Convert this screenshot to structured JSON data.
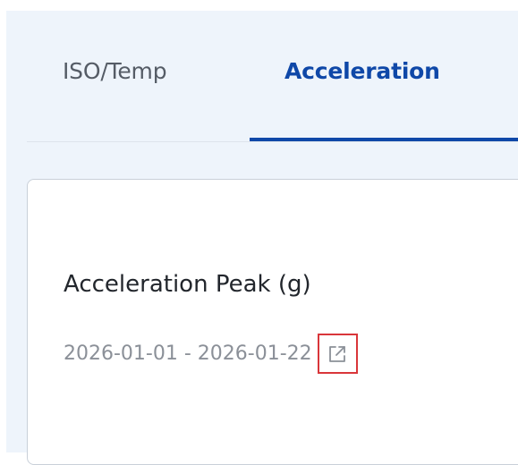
{
  "tabs": [
    {
      "label": "ISO/Temp",
      "active": false
    },
    {
      "label": "Acceleration",
      "active": true
    }
  ],
  "card": {
    "title": "Acceleration Peak (g)",
    "date_range": "2026-01-01 - 2026-01-22",
    "open_icon": "external-link-icon"
  },
  "colors": {
    "accent": "#0f48a8",
    "panel_bg": "#eef4fb",
    "highlight": "#d9363a"
  }
}
